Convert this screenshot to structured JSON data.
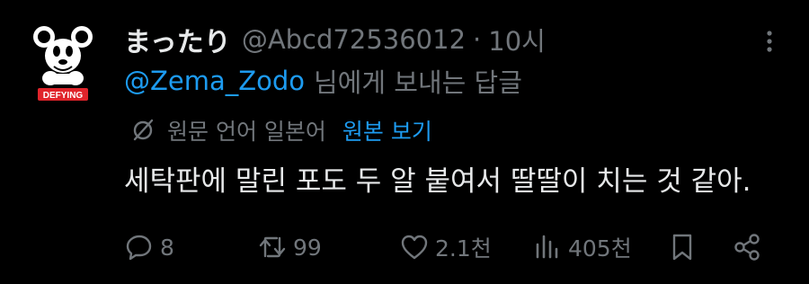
{
  "tweet": {
    "author": {
      "display_name": "まったり",
      "handle": "@Abcd72536012",
      "avatar_badge_text": "DEFYING",
      "avatar_icon": "mouse-character-avatar-icon"
    },
    "separator": "·",
    "time": "10시",
    "more_icon": "more-vertical-icon",
    "reply_to": {
      "mention": "@Zema_Zodo",
      "suffix": "님에게 보내는 답글"
    },
    "translation": {
      "icon": "translate-icon",
      "label": "원문 언어 일본어",
      "link": "원본 보기"
    },
    "text": "세탁판에 말린 포도 두 알 붙여서 딸딸이 치는 것 같아.",
    "actions": {
      "reply": {
        "icon": "reply-icon",
        "count": "8"
      },
      "retweet": {
        "icon": "retweet-icon",
        "count": "99"
      },
      "like": {
        "icon": "heart-icon",
        "count": "2.1천"
      },
      "views": {
        "icon": "views-icon",
        "count": "405천"
      },
      "bookmark": {
        "icon": "bookmark-icon"
      },
      "share": {
        "icon": "share-icon"
      }
    }
  },
  "colors": {
    "background": "#000000",
    "primary_text": "#e7e9ea",
    "secondary_text": "#71767b",
    "accent": "#1d9bf0",
    "badge_red": "#e0242b"
  }
}
